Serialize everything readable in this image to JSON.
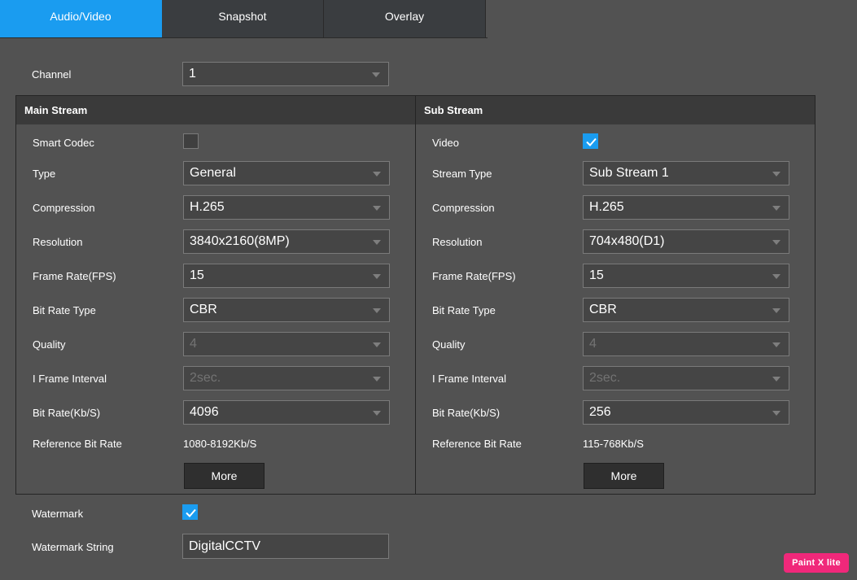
{
  "tabs": [
    {
      "label": "Audio/Video",
      "active": true
    },
    {
      "label": "Snapshot",
      "active": false
    },
    {
      "label": "Overlay",
      "active": false
    }
  ],
  "channel": {
    "label": "Channel",
    "value": "1"
  },
  "main_stream": {
    "title": "Main Stream",
    "smart_codec": {
      "label": "Smart Codec",
      "checked": false
    },
    "type": {
      "label": "Type",
      "value": "General"
    },
    "compression": {
      "label": "Compression",
      "value": "H.265"
    },
    "resolution": {
      "label": "Resolution",
      "value": "3840x2160(8MP)"
    },
    "frame_rate": {
      "label": "Frame Rate(FPS)",
      "value": "15"
    },
    "bit_rate_type": {
      "label": "Bit Rate Type",
      "value": "CBR"
    },
    "quality": {
      "label": "Quality",
      "value": "4",
      "disabled": true
    },
    "i_frame_interval": {
      "label": "I Frame Interval",
      "value": "2sec.",
      "disabled": true
    },
    "bit_rate": {
      "label": "Bit Rate(Kb/S)",
      "value": "4096"
    },
    "reference_bit_rate": {
      "label": "Reference Bit Rate",
      "value": "1080-8192Kb/S"
    },
    "more_label": "More"
  },
  "sub_stream": {
    "title": "Sub Stream",
    "video": {
      "label": "Video",
      "checked": true
    },
    "stream_type": {
      "label": "Stream Type",
      "value": "Sub Stream 1"
    },
    "compression": {
      "label": "Compression",
      "value": "H.265"
    },
    "resolution": {
      "label": "Resolution",
      "value": "704x480(D1)"
    },
    "frame_rate": {
      "label": "Frame Rate(FPS)",
      "value": "15"
    },
    "bit_rate_type": {
      "label": "Bit Rate Type",
      "value": "CBR"
    },
    "quality": {
      "label": "Quality",
      "value": "4",
      "disabled": true
    },
    "i_frame_interval": {
      "label": "I Frame Interval",
      "value": "2sec.",
      "disabled": true
    },
    "bit_rate": {
      "label": "Bit Rate(Kb/S)",
      "value": "256"
    },
    "reference_bit_rate": {
      "label": "Reference Bit Rate",
      "value": "115-768Kb/S"
    },
    "more_label": "More"
  },
  "watermark": {
    "label": "Watermark",
    "checked": true
  },
  "watermark_string": {
    "label": "Watermark String",
    "value": "DigitalCCTV"
  },
  "badge": {
    "label": "Paint X lite"
  },
  "colors": {
    "accent": "#1a9cf0",
    "background": "#525252",
    "header": "#3a3a3a",
    "badge": "#f0287a"
  }
}
